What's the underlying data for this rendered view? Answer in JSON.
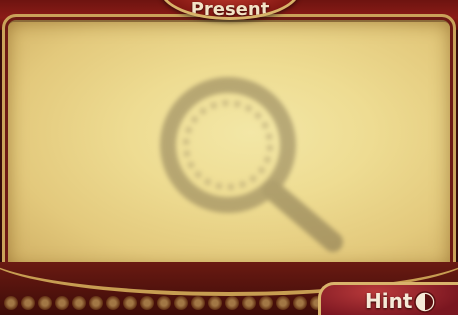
{
  "header": {
    "title": "Present"
  },
  "scene": {
    "placeholder_icon": "magnifying-glass-icon"
  },
  "hint": {
    "label": "Hint",
    "icon": "hint-meter-icon",
    "fill": 0.5
  },
  "colors": {
    "banner_red": "#8b1c17",
    "gold_trim": "#caa25a",
    "parchment": "#eedc92",
    "text_light": "#f6ead8"
  }
}
